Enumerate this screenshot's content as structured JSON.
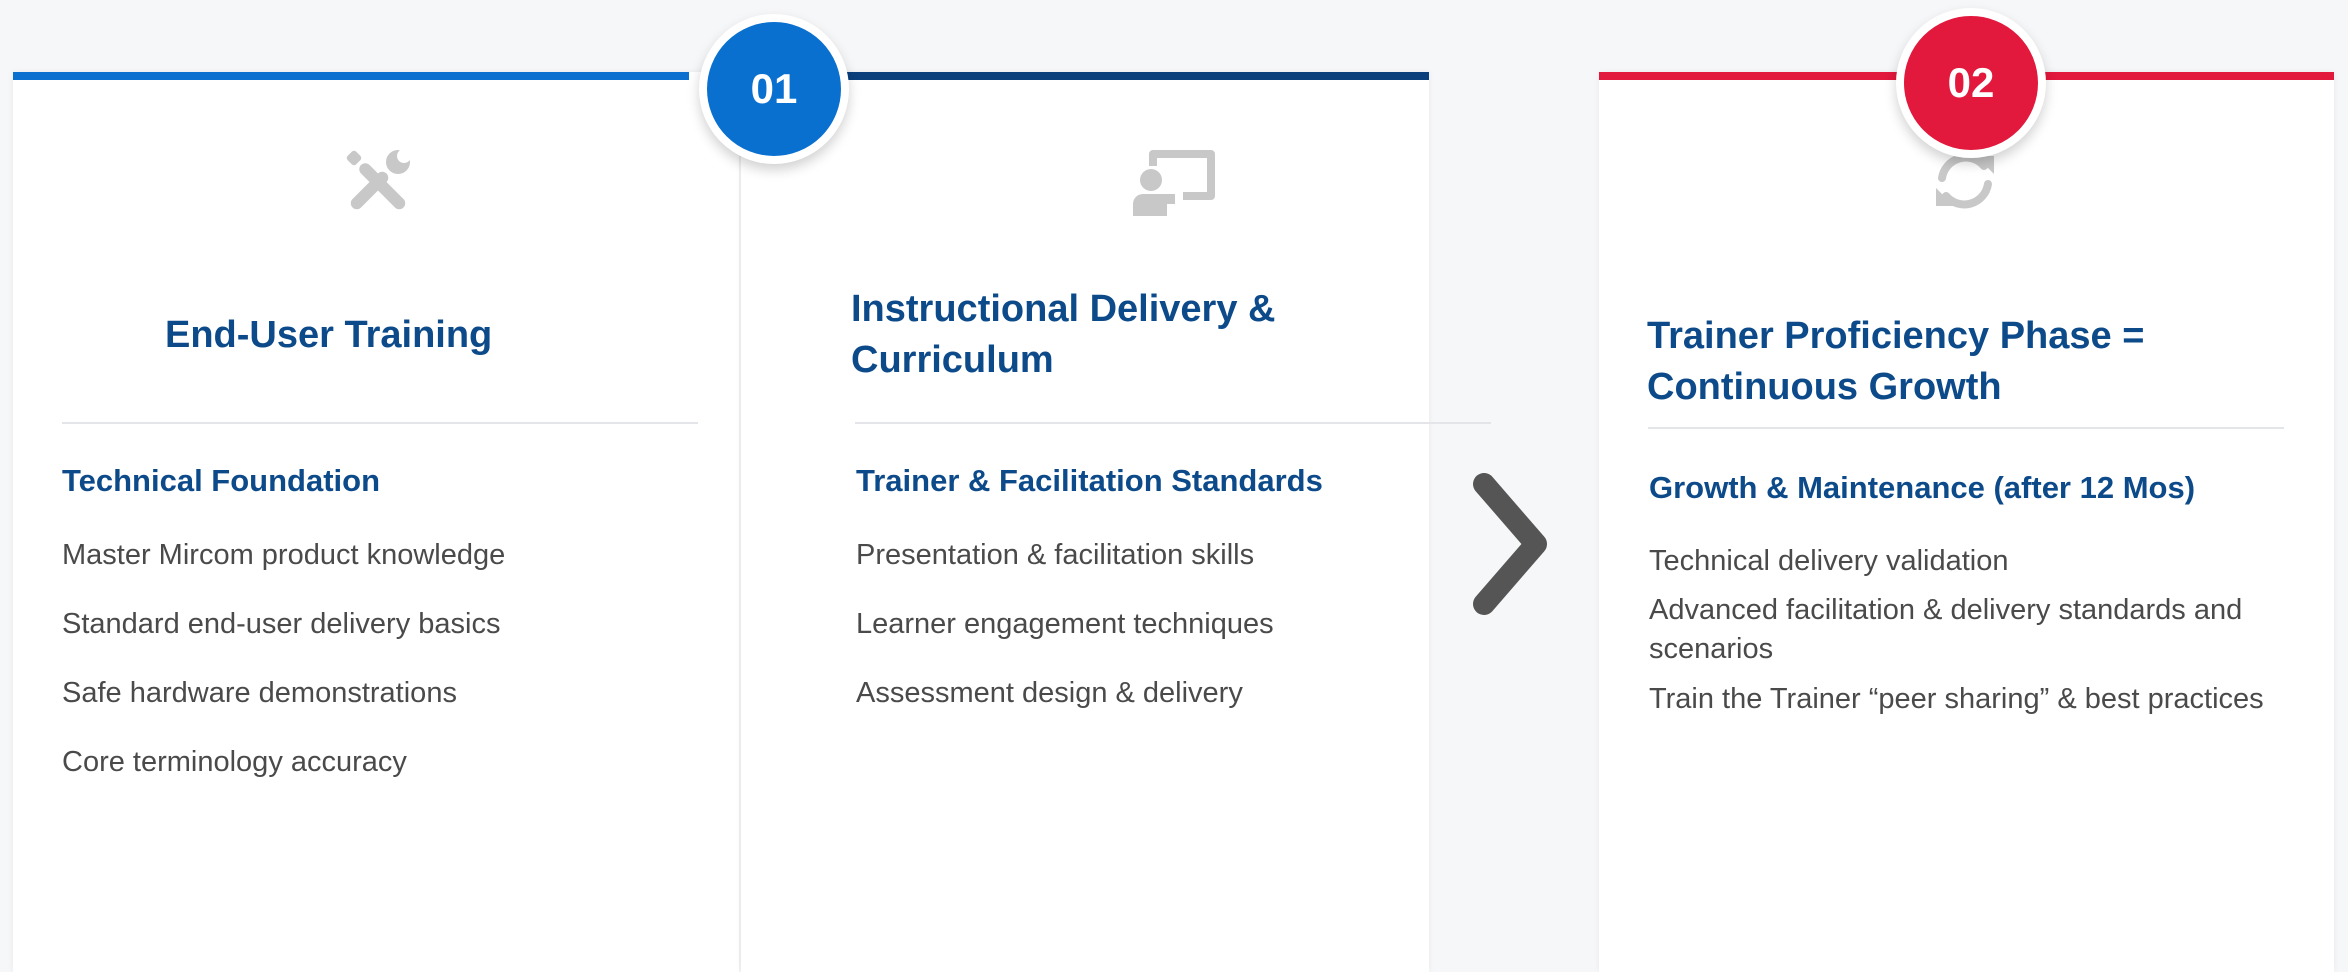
{
  "phases": [
    {
      "badge": "01",
      "color": "#0b6fcf"
    },
    {
      "badge": "02",
      "color": "#e2183d"
    }
  ],
  "cards": [
    {
      "icon": "tools-icon",
      "title": "End-User Training",
      "subheading": "Technical Foundation",
      "items": [
        "Master Mircom product knowledge",
        "Standard end-user delivery basics",
        "Safe hardware demonstrations",
        "Core terminology accuracy"
      ]
    },
    {
      "icon": "presentation-icon",
      "title": "Instructional Delivery & Curriculum",
      "subheading": "Trainer & Facilitation Standards",
      "items": [
        "Presentation & facilitation skills",
        "Learner engagement techniques",
        "Assessment design & delivery"
      ]
    },
    {
      "icon": "refresh-icon",
      "title": "Trainer Proficiency Phase = Continuous Growth",
      "subheading": "Growth & Maintenance (after 12 Mos)",
      "items": [
        "Technical delivery validation",
        "Advanced facilitation & delivery standards and scenarios",
        "Train the Trainer “peer sharing” & best practices"
      ]
    }
  ],
  "connector_icon": "chevron-right-icon"
}
